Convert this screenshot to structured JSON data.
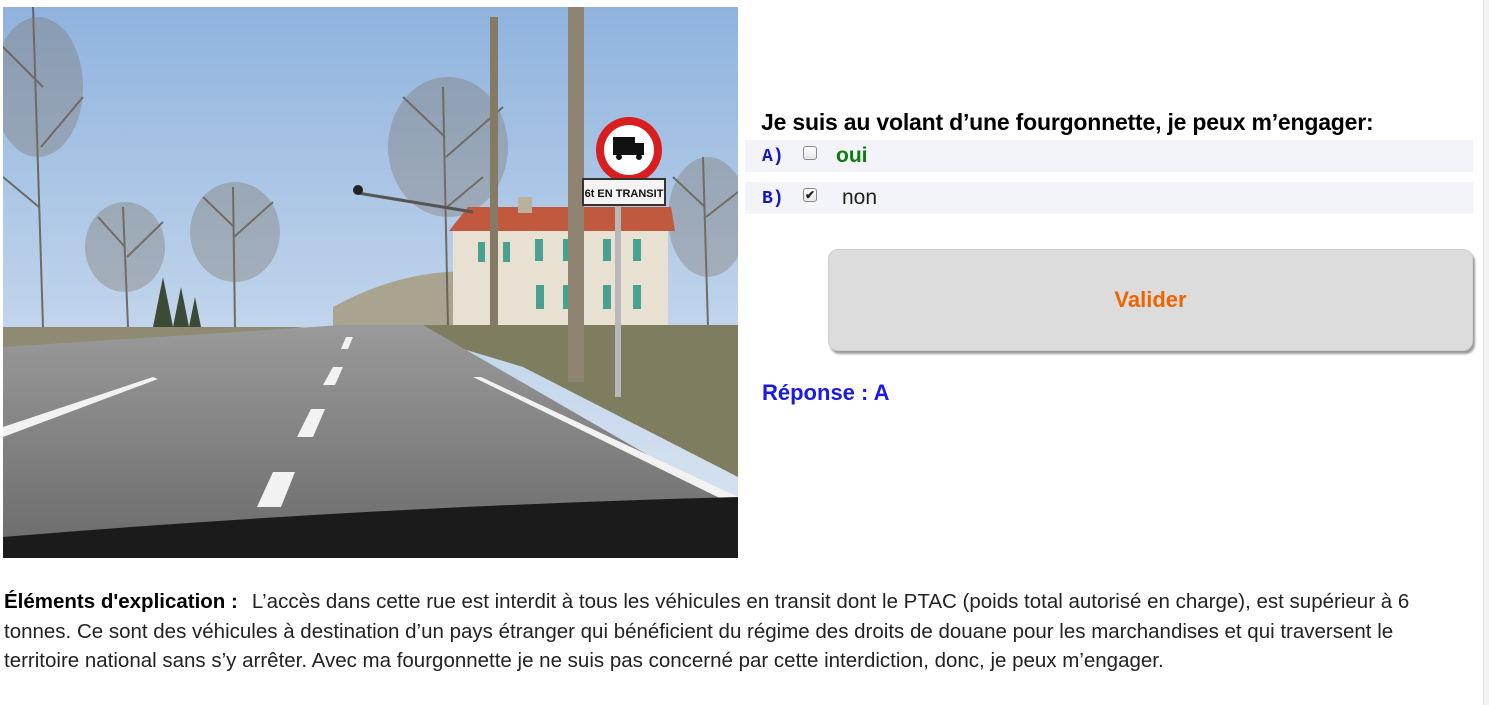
{
  "scene": {
    "sign_label": "6t EN TRANSIT"
  },
  "question": "Je suis au volant d’une fourgonnette, je peux m’engager:",
  "answers": [
    {
      "letter": "A)",
      "label": "oui",
      "checked": false
    },
    {
      "letter": "B)",
      "label": "non",
      "checked": true
    }
  ],
  "submit_label": "Valider",
  "response": "Réponse : A",
  "explanation": {
    "label": "Éléments d'explication :",
    "text": "L’accès dans cette rue est interdit à tous les véhicules en transit dont le PTAC (poids total autorisé en charge), est supérieur à 6 tonnes. Ce sont des véhicules à destination d’un pays étranger qui bénéficient du régime des droits de douane pour les marchandises et qui traversent le territoire national sans s’y arrêter. Avec ma fourgonnette je ne suis pas concerné par cette interdiction, donc, je peux m’engager."
  },
  "colors": {
    "question_letter": "#1515c8",
    "correct_answer": "#0a7d0a",
    "submit_text": "#f06400",
    "response": "#1a1ae6"
  }
}
